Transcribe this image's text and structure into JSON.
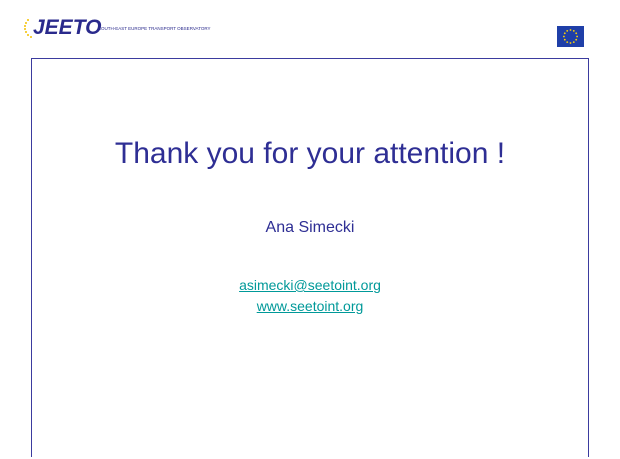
{
  "header": {
    "logo_text": "JEETO",
    "logo_subtitle": "SOUTH-EAST EUROPE TRANSPORT OBSERVATORY",
    "flag_icon": "eu-flag-icon"
  },
  "content": {
    "title": "Thank you for your attention !",
    "author": "Ana Simecki",
    "email": "asimecki@seetoint.org",
    "website": "www.seetoint.org"
  },
  "colors": {
    "text_primary": "#2e2e94",
    "link": "#009999",
    "flag_blue": "#1f3fa8",
    "flag_star": "#ffd400"
  }
}
